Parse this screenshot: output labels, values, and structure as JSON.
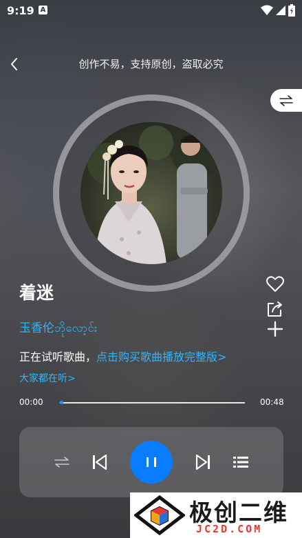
{
  "status_bar": {
    "time": "9:19",
    "notification_letter": "A"
  },
  "header": {
    "notice": "创作不易，支持原创，盗取必究"
  },
  "song": {
    "title": "着迷",
    "artist": "玉香伦ဘိုလော့င်း",
    "trial_prefix": "正在试听歌曲，",
    "trial_link": "点击购买歌曲播放完整版>",
    "listening_link": "大家都在听>"
  },
  "progress": {
    "current": "00:00",
    "total": "00:48",
    "fraction": 0.01
  },
  "colors": {
    "accent": "#0a7cff",
    "link": "#2fb6ff"
  },
  "watermark": {
    "title": "极创二维",
    "subtitle": "JC2D.COM"
  },
  "icons": [
    "back-icon",
    "switch-icon",
    "heart-icon",
    "share-icon",
    "add-icon",
    "loop-icon",
    "previous-icon",
    "pause-icon",
    "next-icon",
    "playlist-icon"
  ]
}
